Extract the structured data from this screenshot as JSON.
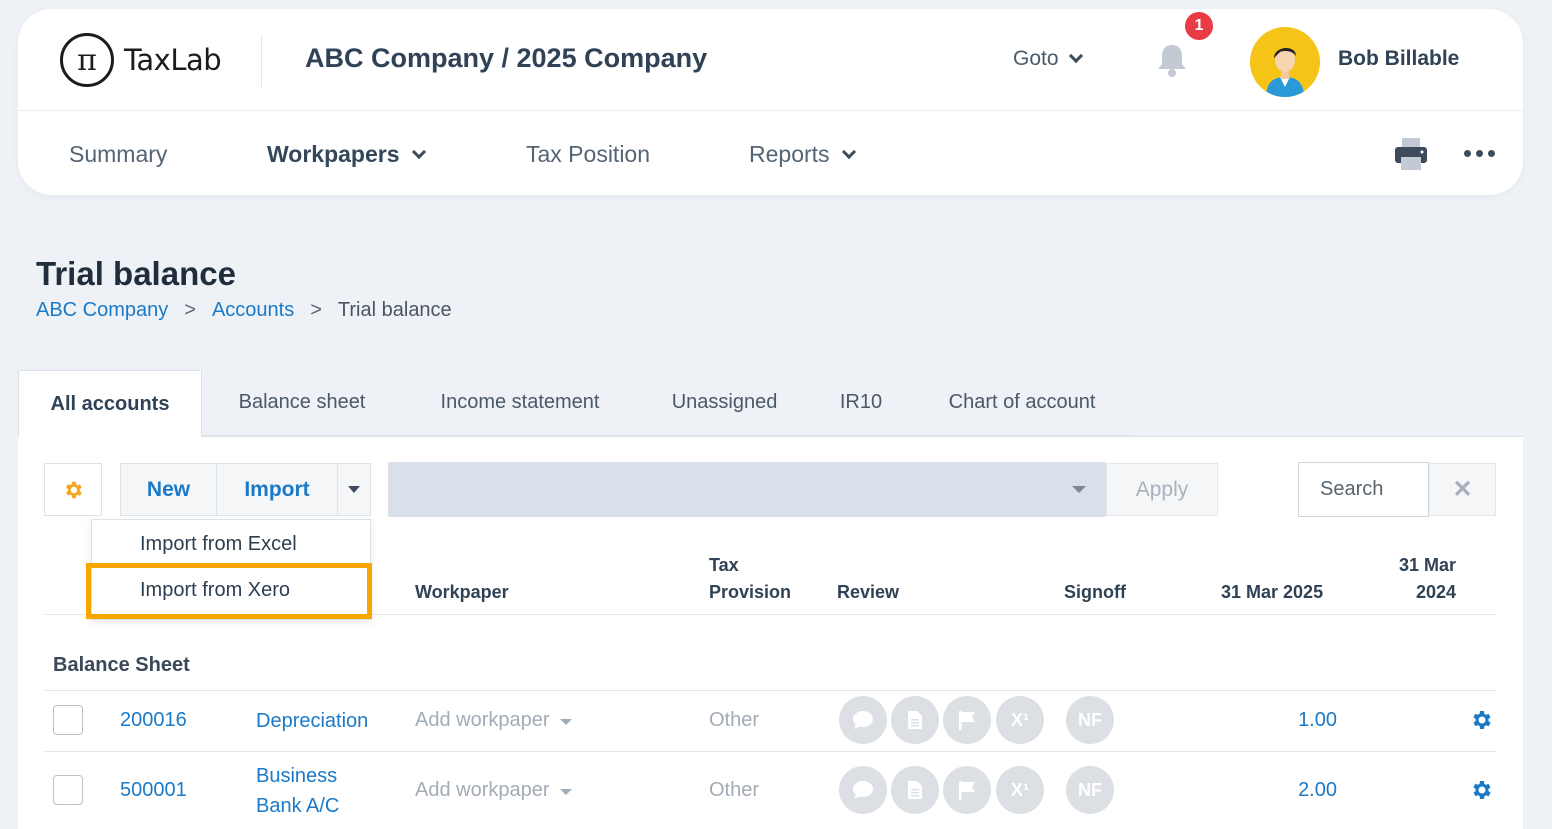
{
  "app": {
    "logo_symbol": "π",
    "logo_text": "TaxLab",
    "company_title": "ABC Company / 2025 Company"
  },
  "header": {
    "goto_label": "Goto",
    "notification_count": "1",
    "user_name": "Bob Billable"
  },
  "nav": {
    "items": [
      {
        "label": "Summary"
      },
      {
        "label": "Workpapers"
      },
      {
        "label": "Tax Position"
      },
      {
        "label": "Reports"
      }
    ]
  },
  "page": {
    "title": "Trial balance"
  },
  "breadcrumb": {
    "items": [
      "ABC Company",
      "Accounts",
      "Trial balance"
    ],
    "separator": ">"
  },
  "tabs": [
    "All accounts",
    "Balance sheet",
    "Income statement",
    "Unassigned",
    "IR10",
    "Chart of account"
  ],
  "toolbar": {
    "new_label": "New",
    "import_label": "Import",
    "apply_label": "Apply",
    "search_placeholder": "Search",
    "clear_label": "✕"
  },
  "import_menu": {
    "items": [
      "Import from Excel",
      "Import from Xero"
    ]
  },
  "table": {
    "columns": {
      "workpaper": "Workpaper",
      "tax_provision_1": "Tax",
      "tax_provision_2": "Provision",
      "review": "Review",
      "signoff": "Signoff",
      "current": "31 Mar 2025",
      "prior_1": "31 Mar",
      "prior_2": "2024"
    },
    "section": "Balance Sheet",
    "rows": [
      {
        "code": "200016",
        "name_1": "Depreciation",
        "name_2": "",
        "workpaper": "Add workpaper",
        "tax_provision": "Other",
        "signoff": "NF",
        "current": "1.00"
      },
      {
        "code": "500001",
        "name_1": "Business",
        "name_2": "Bank A/C",
        "workpaper": "Add workpaper",
        "tax_provision": "Other",
        "signoff": "NF",
        "current": "2.00"
      }
    ]
  },
  "colors": {
    "accent": "#1a7ac8",
    "highlight": "#f7a500",
    "gear": "#f5a623",
    "badge": "#e83b46"
  }
}
